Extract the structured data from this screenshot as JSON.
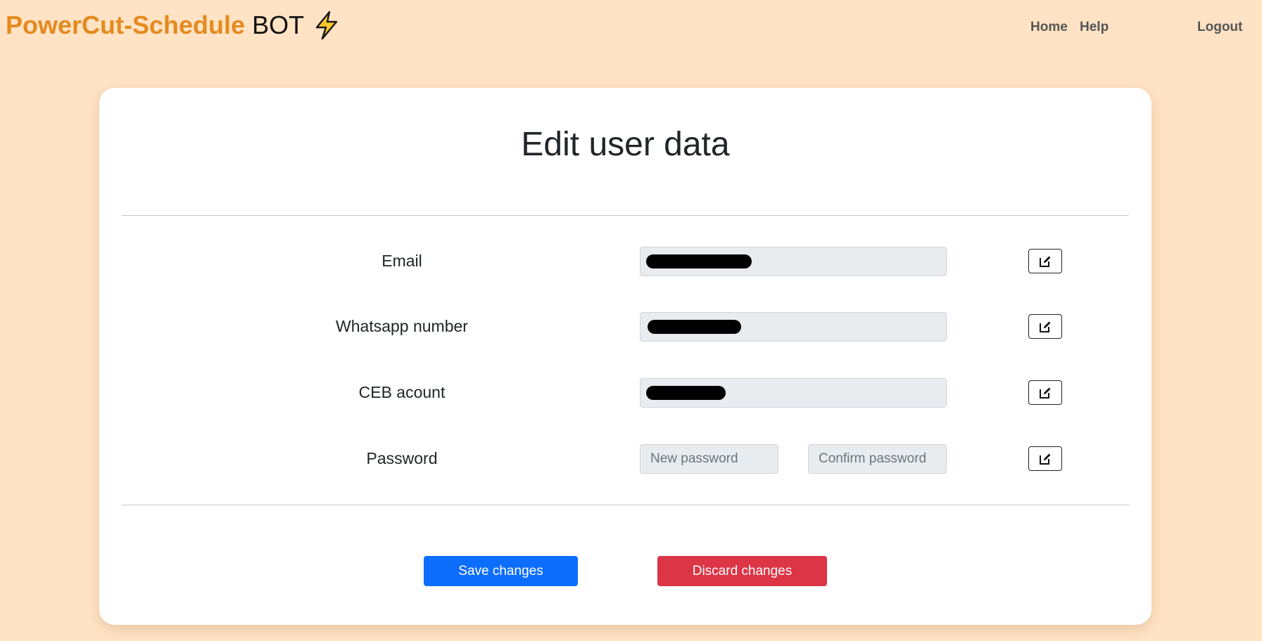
{
  "navbar": {
    "brand_primary": "PowerCut-Schedule",
    "brand_secondary": "BOT",
    "brand_icon": "lightning-bolt-icon",
    "links": [
      {
        "label": "Home"
      },
      {
        "label": "Help"
      },
      {
        "label": "Logout"
      }
    ]
  },
  "form": {
    "title": "Edit user data",
    "rows": [
      {
        "label": "Email",
        "value_redacted": true
      },
      {
        "label": "Whatsapp number",
        "value_redacted": true
      },
      {
        "label": "CEB acount",
        "value_redacted": true
      },
      {
        "label": "Password",
        "new_placeholder": "New password",
        "confirm_placeholder": "Confirm password"
      }
    ],
    "edit_icon": "edit-icon",
    "save_label": "Save changes",
    "discard_label": "Discard changes"
  },
  "colors": {
    "page_background": "#ffe3c4",
    "brand_orange": "#e58a1f",
    "save_button": "#0d6efd",
    "discard_button": "#dc3545"
  }
}
